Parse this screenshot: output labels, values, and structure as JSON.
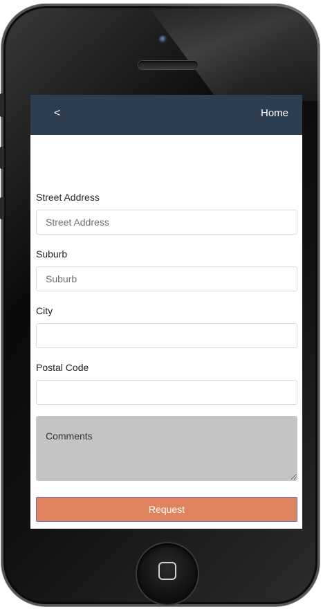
{
  "nav": {
    "back_label": "<",
    "home_label": "Home"
  },
  "form": {
    "street": {
      "label": "Street Address",
      "placeholder": "Street Address",
      "value": ""
    },
    "suburb": {
      "label": "Suburb",
      "placeholder": "Suburb",
      "value": ""
    },
    "city": {
      "label": "City",
      "placeholder": "",
      "value": ""
    },
    "postal": {
      "label": "Postal Code",
      "placeholder": "",
      "value": ""
    },
    "comments": {
      "placeholder": "Comments",
      "value": ""
    },
    "submit_label": "Request"
  },
  "colors": {
    "nav_background": "#2c3e50",
    "button_background": "#e08460",
    "comments_background": "#c4c4c4"
  },
  "icons": {
    "device_camera": "camera-icon",
    "device_home": "home-button-icon"
  }
}
